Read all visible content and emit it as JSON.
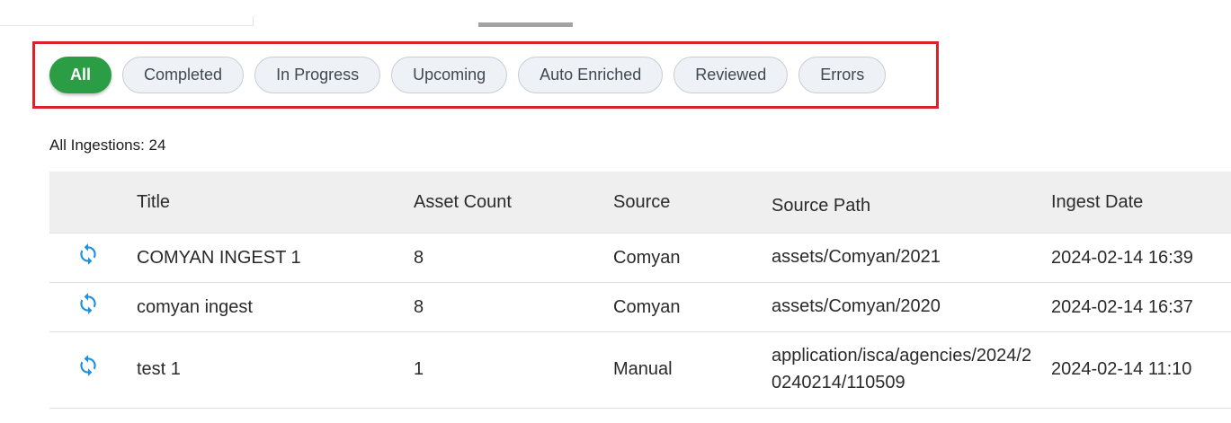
{
  "filters": {
    "chips": [
      {
        "label": "All",
        "active": true
      },
      {
        "label": "Completed",
        "active": false
      },
      {
        "label": "In Progress",
        "active": false
      },
      {
        "label": "Upcoming",
        "active": false
      },
      {
        "label": "Auto Enriched",
        "active": false
      },
      {
        "label": "Reviewed",
        "active": false
      },
      {
        "label": "Errors",
        "active": false
      }
    ]
  },
  "summary": {
    "count_label": "All Ingestions: 24"
  },
  "table": {
    "headers": {
      "title": "Title",
      "asset_count": "Asset Count",
      "source": "Source",
      "source_path": "Source Path",
      "ingest_date": "Ingest Date"
    },
    "rows": [
      {
        "icon": "sync-icon",
        "title": "COMYAN INGEST 1",
        "asset_count": "8",
        "source": "Comyan",
        "source_path": "assets/Comyan/2021",
        "ingest_date": "2024-02-14 16:39"
      },
      {
        "icon": "sync-icon",
        "title": "comyan ingest",
        "asset_count": "8",
        "source": "Comyan",
        "source_path": "assets/Comyan/2020",
        "ingest_date": "2024-02-14 16:37"
      },
      {
        "icon": "sync-icon",
        "title": "test 1",
        "asset_count": "1",
        "source": "Manual",
        "source_path": "application/isca/agencies/2024/20240214/110509",
        "ingest_date": "2024-02-14 11:10"
      }
    ]
  },
  "colors": {
    "active_chip": "#2a9d45",
    "highlight_frame": "#d9222a",
    "sync_icon": "#1e90e0"
  }
}
